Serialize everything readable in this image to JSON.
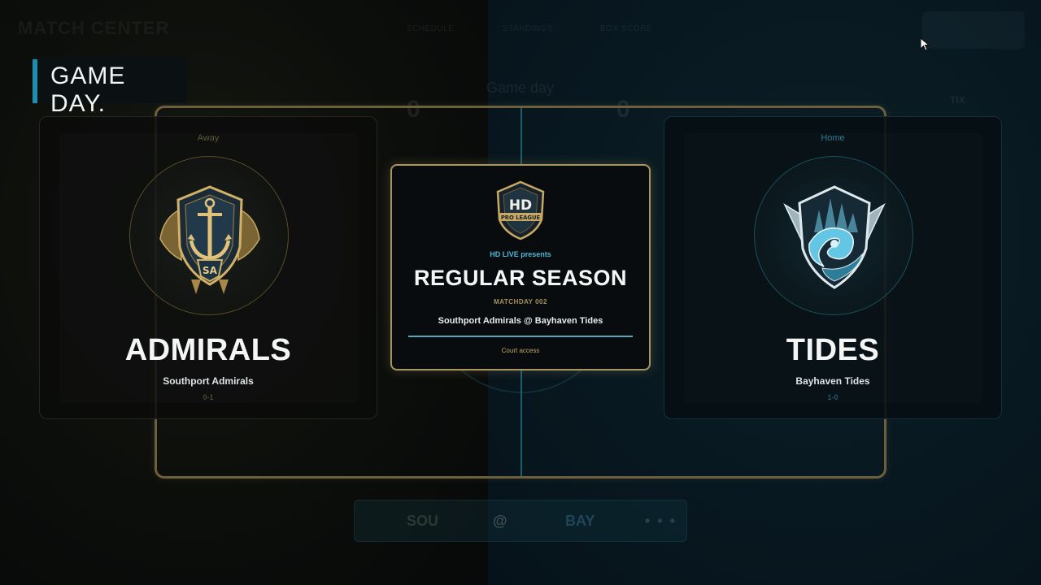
{
  "background": {
    "title": "MATCH CENTER",
    "nav": [
      "SCHEDULE",
      "STANDINGS",
      "BOX SCORE"
    ],
    "score_away": "0",
    "score_home": "0",
    "game_day_label": "Game day",
    "ticket_label": "TIX"
  },
  "header": {
    "title": "GAME DAY."
  },
  "away": {
    "side": "Away",
    "name": "ADMIRALS",
    "full_name": "Southport Admirals",
    "record": "0-1",
    "crest_icon": "anchor-shield-crest",
    "crest_initials": "SA",
    "color": "#b79a55"
  },
  "home": {
    "side": "Home",
    "name": "TIDES",
    "full_name": "Bayhaven Tides",
    "record": "1-0",
    "crest_icon": "wave-shield-crest",
    "color": "#3fa5c4"
  },
  "center": {
    "logo_icon": "hd-pro-league-logo",
    "logo_main": "HD",
    "logo_sub": "PRO LEAGUE",
    "presents": "HD LIVE presents",
    "title": "REGULAR SEASON",
    "matchday": "MATCHDAY 002",
    "matchup": "Southport Admirals @ Bayhaven Tides",
    "action": "Court access"
  },
  "bottom_bar": {
    "away_abbr": "SOU",
    "at": "@",
    "home_abbr": "BAY",
    "more": "• • •"
  }
}
